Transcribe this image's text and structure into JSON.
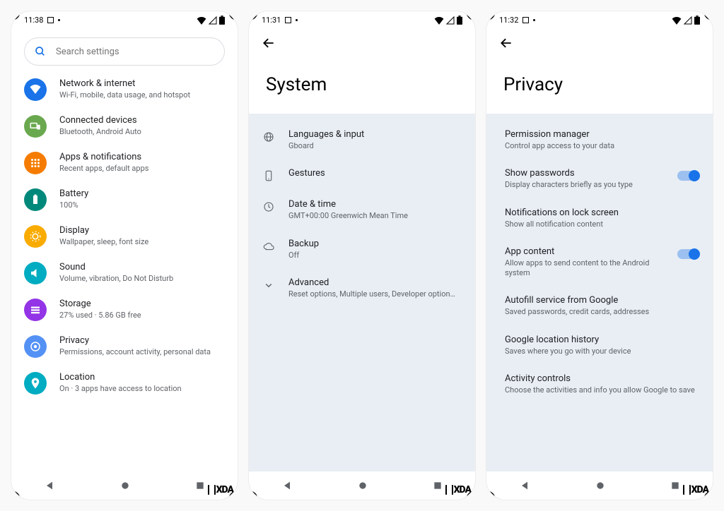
{
  "watermark": "XDA",
  "phone1": {
    "time": "11:38",
    "search_placeholder": "Search settings",
    "items": [
      {
        "title": "Network & internet",
        "sub": "Wi-Fi, mobile, data usage, and hotspot",
        "color": "#1a73e8",
        "icon": "wifi"
      },
      {
        "title": "Connected devices",
        "sub": "Bluetooth, Android Auto",
        "color": "#6aa84f",
        "icon": "devices"
      },
      {
        "title": "Apps & notifications",
        "sub": "Recent apps, default apps",
        "color": "#f57c00",
        "icon": "apps"
      },
      {
        "title": "Battery",
        "sub": "100%",
        "color": "#00897b",
        "icon": "battery"
      },
      {
        "title": "Display",
        "sub": "Wallpaper, sleep, font size",
        "color": "#f9ab00",
        "icon": "display"
      },
      {
        "title": "Sound",
        "sub": "Volume, vibration, Do Not Disturb",
        "color": "#00acc1",
        "icon": "sound"
      },
      {
        "title": "Storage",
        "sub": "27% used · 5.86 GB free",
        "color": "#9334e6",
        "icon": "storage"
      },
      {
        "title": "Privacy",
        "sub": "Permissions, account activity, personal data",
        "color": "#5491f5",
        "icon": "privacy"
      },
      {
        "title": "Location",
        "sub": "On · 3 apps have access to location",
        "color": "#00acc1",
        "icon": "location"
      }
    ]
  },
  "phone2": {
    "time": "11:31",
    "title": "System",
    "items": [
      {
        "title": "Languages & input",
        "sub": "Gboard",
        "icon": "globe"
      },
      {
        "title": "Gestures",
        "sub": "",
        "icon": "gesture"
      },
      {
        "title": "Date & time",
        "sub": "GMT+00:00 Greenwich Mean Time",
        "icon": "clock"
      },
      {
        "title": "Backup",
        "sub": "Off",
        "icon": "cloud"
      },
      {
        "title": "Advanced",
        "sub": "Reset options, Multiple users, Developer option…",
        "icon": "chevron"
      }
    ]
  },
  "phone3": {
    "time": "11:32",
    "title": "Privacy",
    "items": [
      {
        "title": "Permission manager",
        "sub": "Control app access to your data",
        "toggle": false
      },
      {
        "title": "Show passwords",
        "sub": "Display characters briefly as you type",
        "toggle": true
      },
      {
        "title": "Notifications on lock screen",
        "sub": "Show all notification content",
        "toggle": false
      },
      {
        "title": "App content",
        "sub": "Allow apps to send content to the Android system",
        "toggle": true
      },
      {
        "title": "Autofill service from Google",
        "sub": "Saved passwords, credit cards, addresses",
        "toggle": false
      },
      {
        "title": "Google location history",
        "sub": "Saves where you go with your device",
        "toggle": false
      },
      {
        "title": "Activity controls",
        "sub": "Choose the activities and info you allow Google to save",
        "toggle": false
      }
    ]
  }
}
